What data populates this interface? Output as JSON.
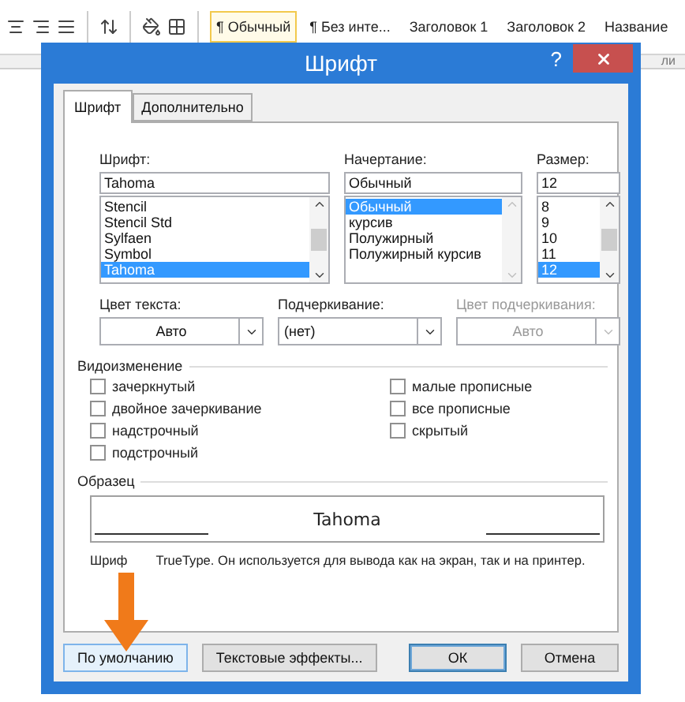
{
  "ribbon": {
    "styles": [
      {
        "label": "¶ Обычный",
        "selected": true
      },
      {
        "label": "¶ Без инте...",
        "selected": false
      },
      {
        "label": "Заголовок 1",
        "selected": false
      },
      {
        "label": "Заголовок 2",
        "selected": false
      },
      {
        "label": "Название",
        "selected": false
      }
    ],
    "group_label": "ли"
  },
  "dialog": {
    "title": "Шрифт",
    "help": "?",
    "tabs": [
      {
        "label": "Шрифт",
        "selected": true
      },
      {
        "label": "Дополнительно",
        "selected": false
      }
    ],
    "pickers": [
      {
        "label": "Шрифт:",
        "value": "Tahoma",
        "scroll": true,
        "options": [
          {
            "label": "Stencil",
            "selected": false
          },
          {
            "label": "Stencil Std",
            "selected": false
          },
          {
            "label": "Sylfaen",
            "selected": false
          },
          {
            "label": "Symbol",
            "selected": false
          },
          {
            "label": "Tahoma",
            "selected": true
          }
        ]
      },
      {
        "label": "Начертание:",
        "value": "Обычный",
        "scroll": false,
        "options": [
          {
            "label": "Обычный",
            "selected": true
          },
          {
            "label": "курсив",
            "selected": false
          },
          {
            "label": "Полужирный",
            "selected": false
          },
          {
            "label": "Полужирный курсив",
            "selected": false
          }
        ]
      },
      {
        "label": "Размер:",
        "value": "12",
        "scroll": true,
        "options": [
          {
            "label": "8",
            "selected": false
          },
          {
            "label": "9",
            "selected": false
          },
          {
            "label": "10",
            "selected": false
          },
          {
            "label": "11",
            "selected": false
          },
          {
            "label": "12",
            "selected": true
          }
        ]
      }
    ],
    "dropdowns": [
      {
        "label": "Цвет текста:",
        "value": "Авто",
        "centered": true,
        "disabled": false
      },
      {
        "label": "Подчеркивание:",
        "value": "(нет)",
        "centered": false,
        "disabled": false
      },
      {
        "label": "Цвет подчеркивания:",
        "value": "Авто",
        "centered": true,
        "disabled": true
      }
    ],
    "effects": {
      "title": "Видоизменение",
      "left": [
        {
          "label": "зачеркнутый",
          "checked": false
        },
        {
          "label": "двойное зачеркивание",
          "checked": false
        },
        {
          "label": "надстрочный",
          "checked": false
        },
        {
          "label": "подстрочный",
          "checked": false
        }
      ],
      "right": [
        {
          "label": "малые прописные",
          "checked": false
        },
        {
          "label": "все прописные",
          "checked": false
        },
        {
          "label": "скрытый",
          "checked": false
        }
      ]
    },
    "sample": {
      "title": "Образец",
      "text": "Tahoma"
    },
    "note": {
      "before": "Шриф",
      "after": "TrueType. Он используется для вывода как на экран, так и на принтер."
    },
    "buttons_left": [
      {
        "label": "По умолчанию",
        "highlighted": true,
        "default": false
      },
      {
        "label": "Текстовые эффекты...",
        "highlighted": false,
        "default": false
      }
    ],
    "buttons_right": [
      {
        "label": "ОК",
        "highlighted": false,
        "default": true
      },
      {
        "label": "Отмена",
        "highlighted": false,
        "default": false
      }
    ]
  }
}
